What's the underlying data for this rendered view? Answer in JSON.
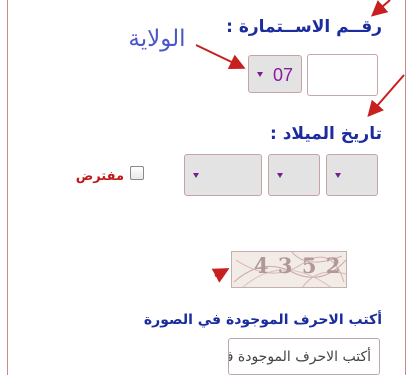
{
  "form": {
    "form_number_label": "رقــم الاســتمارة :",
    "state_annotation": "الولاية",
    "state_select_value": "07",
    "birth_date_label": "تاريخ الميلاد :",
    "presumed_label": "مفترض",
    "captcha_text": "4 3 5 2",
    "captcha_prompt": "أكتب الاحرف الموجودة في الصورة",
    "captcha_input_placeholder": "أكتب الاحرف الموجودة في الصورة"
  },
  "colors": {
    "label_blue": "#1a2c9e",
    "annotation_blue": "#4b57c8",
    "arrow_red": "#c81f1f",
    "select_text_purple": "#8a1aa0",
    "presumed_red": "#c01818",
    "frame_border": "#c98a8a"
  }
}
